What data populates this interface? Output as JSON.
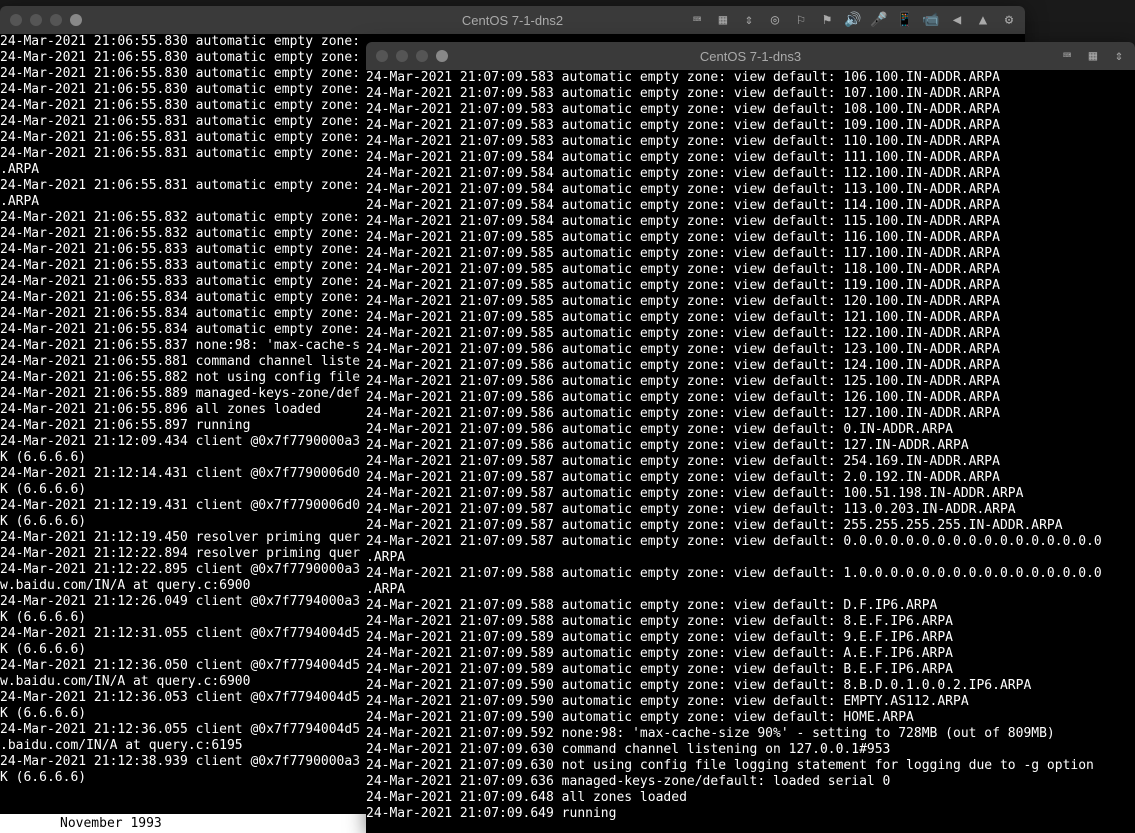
{
  "window1": {
    "title": "CentOS 7-1-dns2",
    "lines": [
      "24-Mar-2021 21:06:55.830 automatic empty zone:",
      "24-Mar-2021 21:06:55.830 automatic empty zone:",
      "24-Mar-2021 21:06:55.830 automatic empty zone:",
      "24-Mar-2021 21:06:55.830 automatic empty zone:",
      "24-Mar-2021 21:06:55.830 automatic empty zone:",
      "24-Mar-2021 21:06:55.831 automatic empty zone:",
      "24-Mar-2021 21:06:55.831 automatic empty zone:",
      "24-Mar-2021 21:06:55.831 automatic empty zone:",
      ".ARPA",
      "24-Mar-2021 21:06:55.831 automatic empty zone:",
      ".ARPA",
      "24-Mar-2021 21:06:55.832 automatic empty zone:",
      "24-Mar-2021 21:06:55.832 automatic empty zone:",
      "24-Mar-2021 21:06:55.833 automatic empty zone:",
      "24-Mar-2021 21:06:55.833 automatic empty zone:",
      "24-Mar-2021 21:06:55.833 automatic empty zone:",
      "24-Mar-2021 21:06:55.834 automatic empty zone:",
      "24-Mar-2021 21:06:55.834 automatic empty zone:",
      "24-Mar-2021 21:06:55.834 automatic empty zone:",
      "24-Mar-2021 21:06:55.837 none:98: 'max-cache-s",
      "24-Mar-2021 21:06:55.881 command channel liste",
      "24-Mar-2021 21:06:55.882 not using config file",
      "24-Mar-2021 21:06:55.889 managed-keys-zone/def",
      "24-Mar-2021 21:06:55.896 all zones loaded",
      "24-Mar-2021 21:06:55.897 running",
      "24-Mar-2021 21:12:09.434 client @0x7f7790000a3",
      "K (6.6.6.6)",
      "24-Mar-2021 21:12:14.431 client @0x7f7790006d0",
      "K (6.6.6.6)",
      "24-Mar-2021 21:12:19.431 client @0x7f7790006d0",
      "K (6.6.6.6)",
      "24-Mar-2021 21:12:19.450 resolver priming quer",
      "24-Mar-2021 21:12:22.894 resolver priming quer",
      "24-Mar-2021 21:12:22.895 client @0x7f7790000a3",
      "w.baidu.com/IN/A at query.c:6900",
      "24-Mar-2021 21:12:26.049 client @0x7f7794000a3",
      "K (6.6.6.6)",
      "24-Mar-2021 21:12:31.055 client @0x7f7794004d5",
      "K (6.6.6.6)",
      "24-Mar-2021 21:12:36.050 client @0x7f7794004d5",
      "w.baidu.com/IN/A at query.c:6900",
      "24-Mar-2021 21:12:36.053 client @0x7f7794004d5",
      "K (6.6.6.6)",
      "24-Mar-2021 21:12:36.055 client @0x7f7794004d5",
      ".baidu.com/IN/A at query.c:6195",
      "24-Mar-2021 21:12:38.939 client @0x7f7790000a3",
      "K (6.6.6.6)"
    ],
    "footer": "November 1993"
  },
  "window2": {
    "title": "CentOS 7-1-dns3",
    "lines": [
      "24-Mar-2021 21:07:09.583 automatic empty zone: view default: 106.100.IN-ADDR.ARPA",
      "24-Mar-2021 21:07:09.583 automatic empty zone: view default: 107.100.IN-ADDR.ARPA",
      "24-Mar-2021 21:07:09.583 automatic empty zone: view default: 108.100.IN-ADDR.ARPA",
      "24-Mar-2021 21:07:09.583 automatic empty zone: view default: 109.100.IN-ADDR.ARPA",
      "24-Mar-2021 21:07:09.583 automatic empty zone: view default: 110.100.IN-ADDR.ARPA",
      "24-Mar-2021 21:07:09.584 automatic empty zone: view default: 111.100.IN-ADDR.ARPA",
      "24-Mar-2021 21:07:09.584 automatic empty zone: view default: 112.100.IN-ADDR.ARPA",
      "24-Mar-2021 21:07:09.584 automatic empty zone: view default: 113.100.IN-ADDR.ARPA",
      "24-Mar-2021 21:07:09.584 automatic empty zone: view default: 114.100.IN-ADDR.ARPA",
      "24-Mar-2021 21:07:09.584 automatic empty zone: view default: 115.100.IN-ADDR.ARPA",
      "24-Mar-2021 21:07:09.585 automatic empty zone: view default: 116.100.IN-ADDR.ARPA",
      "24-Mar-2021 21:07:09.585 automatic empty zone: view default: 117.100.IN-ADDR.ARPA",
      "24-Mar-2021 21:07:09.585 automatic empty zone: view default: 118.100.IN-ADDR.ARPA",
      "24-Mar-2021 21:07:09.585 automatic empty zone: view default: 119.100.IN-ADDR.ARPA",
      "24-Mar-2021 21:07:09.585 automatic empty zone: view default: 120.100.IN-ADDR.ARPA",
      "24-Mar-2021 21:07:09.585 automatic empty zone: view default: 121.100.IN-ADDR.ARPA",
      "24-Mar-2021 21:07:09.585 automatic empty zone: view default: 122.100.IN-ADDR.ARPA",
      "24-Mar-2021 21:07:09.586 automatic empty zone: view default: 123.100.IN-ADDR.ARPA",
      "24-Mar-2021 21:07:09.586 automatic empty zone: view default: 124.100.IN-ADDR.ARPA",
      "24-Mar-2021 21:07:09.586 automatic empty zone: view default: 125.100.IN-ADDR.ARPA",
      "24-Mar-2021 21:07:09.586 automatic empty zone: view default: 126.100.IN-ADDR.ARPA",
      "24-Mar-2021 21:07:09.586 automatic empty zone: view default: 127.100.IN-ADDR.ARPA",
      "24-Mar-2021 21:07:09.586 automatic empty zone: view default: 0.IN-ADDR.ARPA",
      "24-Mar-2021 21:07:09.586 automatic empty zone: view default: 127.IN-ADDR.ARPA",
      "24-Mar-2021 21:07:09.587 automatic empty zone: view default: 254.169.IN-ADDR.ARPA",
      "24-Mar-2021 21:07:09.587 automatic empty zone: view default: 2.0.192.IN-ADDR.ARPA",
      "24-Mar-2021 21:07:09.587 automatic empty zone: view default: 100.51.198.IN-ADDR.ARPA",
      "24-Mar-2021 21:07:09.587 automatic empty zone: view default: 113.0.203.IN-ADDR.ARPA",
      "24-Mar-2021 21:07:09.587 automatic empty zone: view default: 255.255.255.255.IN-ADDR.ARPA",
      "24-Mar-2021 21:07:09.587 automatic empty zone: view default: 0.0.0.0.0.0.0.0.0.0.0.0.0.0.0.0.0",
      ".ARPA",
      "24-Mar-2021 21:07:09.588 automatic empty zone: view default: 1.0.0.0.0.0.0.0.0.0.0.0.0.0.0.0.0",
      ".ARPA",
      "24-Mar-2021 21:07:09.588 automatic empty zone: view default: D.F.IP6.ARPA",
      "24-Mar-2021 21:07:09.588 automatic empty zone: view default: 8.E.F.IP6.ARPA",
      "24-Mar-2021 21:07:09.589 automatic empty zone: view default: 9.E.F.IP6.ARPA",
      "24-Mar-2021 21:07:09.589 automatic empty zone: view default: A.E.F.IP6.ARPA",
      "24-Mar-2021 21:07:09.589 automatic empty zone: view default: B.E.F.IP6.ARPA",
      "24-Mar-2021 21:07:09.590 automatic empty zone: view default: 8.B.D.0.1.0.0.2.IP6.ARPA",
      "24-Mar-2021 21:07:09.590 automatic empty zone: view default: EMPTY.AS112.ARPA",
      "24-Mar-2021 21:07:09.590 automatic empty zone: view default: HOME.ARPA",
      "24-Mar-2021 21:07:09.592 none:98: 'max-cache-size 90%' - setting to 728MB (out of 809MB)",
      "24-Mar-2021 21:07:09.630 command channel listening on 127.0.0.1#953",
      "24-Mar-2021 21:07:09.630 not using config file logging statement for logging due to -g option",
      "24-Mar-2021 21:07:09.636 managed-keys-zone/default: loaded serial 0",
      "24-Mar-2021 21:07:09.648 all zones loaded",
      "24-Mar-2021 21:07:09.649 running"
    ]
  },
  "toolbar_icons": [
    "⌨",
    "▦",
    "⇕",
    "◎",
    "⚐",
    "⚑",
    "🔊",
    "🎤",
    "📱",
    "📹",
    "◀",
    "▲",
    "⚙"
  ]
}
